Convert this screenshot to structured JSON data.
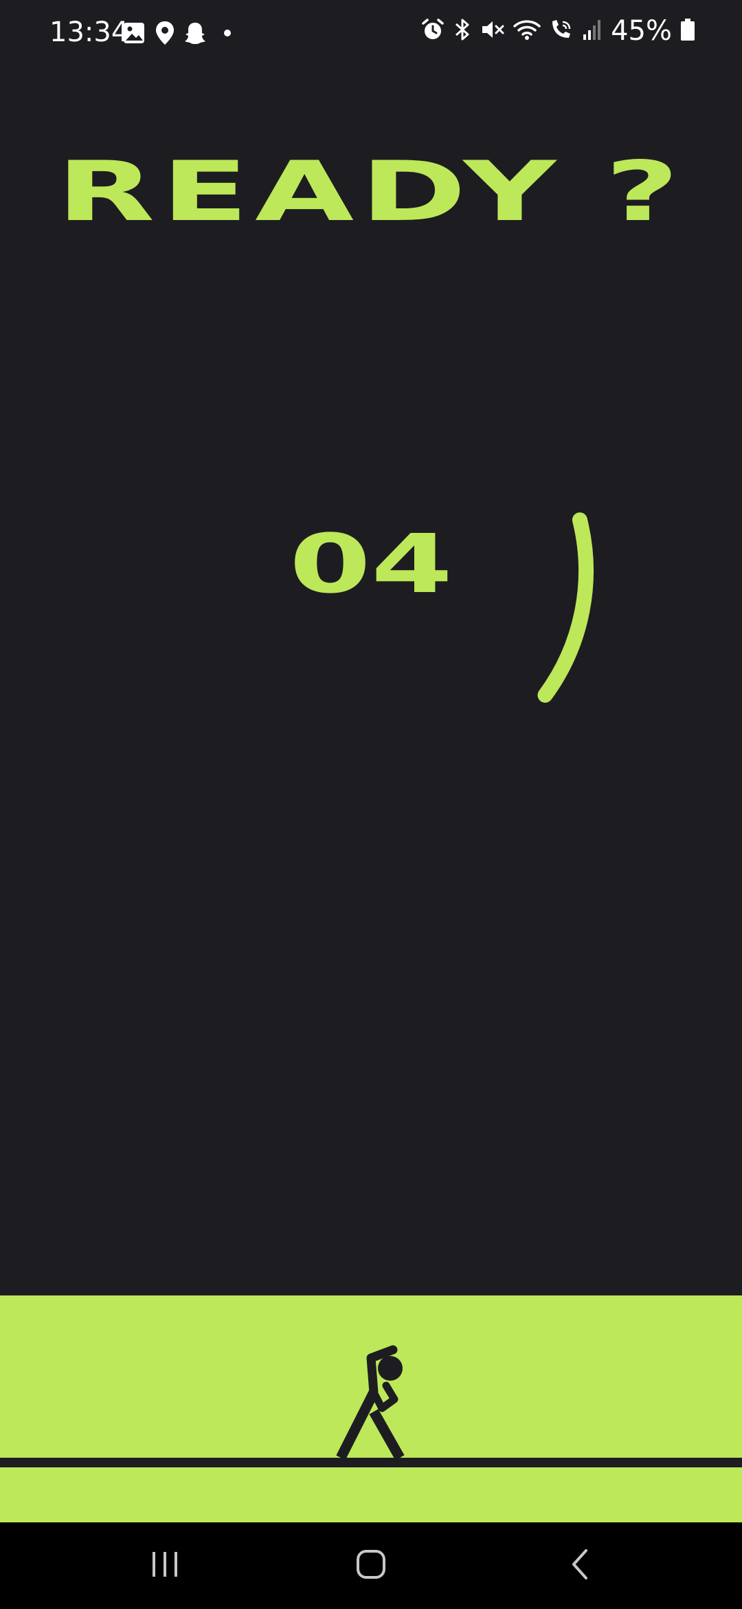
{
  "status_bar": {
    "time": "13:34",
    "battery_percent": "45%",
    "left_icons": [
      "gallery-icon",
      "location-icon",
      "snapchat-ghost-icon",
      "dot-icon"
    ],
    "right_icons": [
      "alarm-icon",
      "bluetooth-icon",
      "mute-icon",
      "wifi-icon",
      "wifi-calling-icon",
      "signal-icon",
      "battery-icon"
    ]
  },
  "screen": {
    "title_word": "READY",
    "title_mark": "?",
    "countdown": "04",
    "countdown_progress": 0.14
  },
  "colors": {
    "background": "#1d1d21",
    "accent": "#bde85a",
    "nav_bar": "#000000"
  },
  "illustration": {
    "icon": "stretching-person-icon"
  },
  "nav": {
    "recents_icon": "recent-apps-icon",
    "home_icon": "home-icon",
    "back_icon": "back-icon"
  }
}
